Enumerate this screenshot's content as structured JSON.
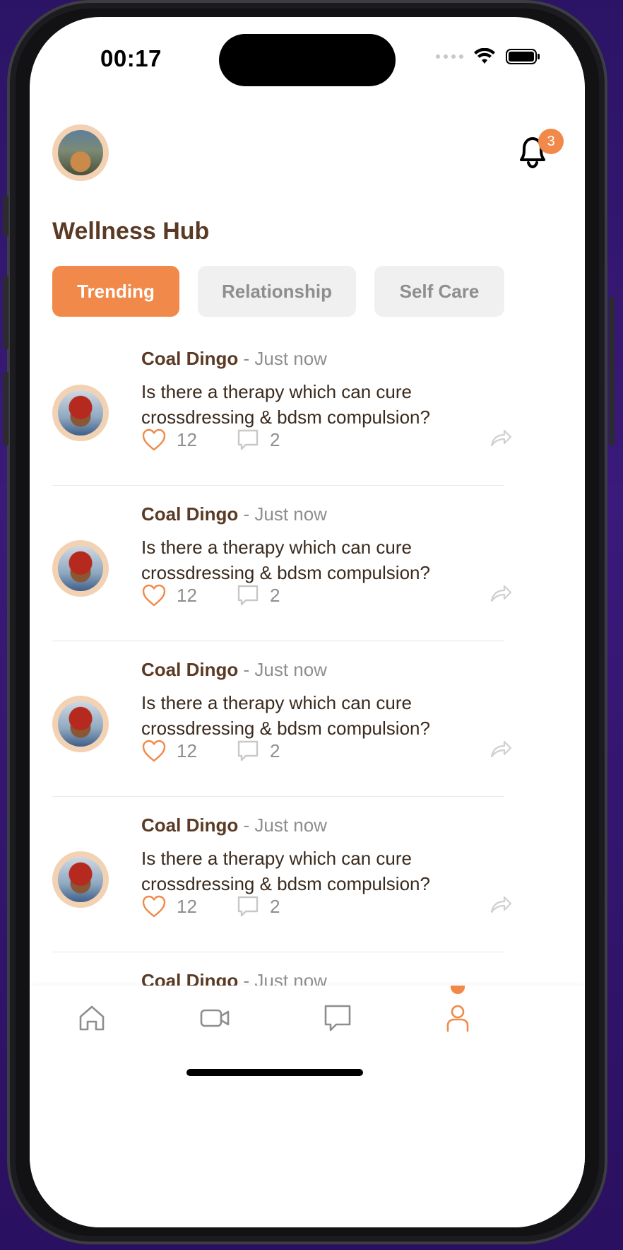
{
  "status_bar": {
    "time": "00:17"
  },
  "header": {
    "notification_count": "3",
    "title": "Wellness Hub"
  },
  "tabs": [
    {
      "label": "Trending",
      "active": true
    },
    {
      "label": "Relationship",
      "active": false
    },
    {
      "label": "Self Care",
      "active": false
    }
  ],
  "posts": [
    {
      "author": "Coal Dingo",
      "separator": "-",
      "time": "Just now",
      "text": "Is there a therapy which can cure crossdressing & bdsm compulsion?",
      "likes": "12",
      "comments": "2"
    },
    {
      "author": "Coal Dingo",
      "separator": "-",
      "time": "Just now",
      "text": "Is there a therapy which can cure crossdressing & bdsm compulsion?",
      "likes": "12",
      "comments": "2"
    },
    {
      "author": "Coal Dingo",
      "separator": "-",
      "time": "Just now",
      "text": "Is there a therapy which can cure crossdressing & bdsm compulsion?",
      "likes": "12",
      "comments": "2"
    },
    {
      "author": "Coal Dingo",
      "separator": "-",
      "time": "Just now",
      "text": "Is there a therapy which can cure crossdressing & bdsm compulsion?",
      "likes": "12",
      "comments": "2"
    },
    {
      "author": "Coal Dingo",
      "separator": "-",
      "time": "Just now"
    }
  ],
  "bottom_nav": [
    {
      "icon": "home-icon",
      "active": false
    },
    {
      "icon": "video-icon",
      "active": false
    },
    {
      "icon": "chat-icon",
      "active": false
    },
    {
      "icon": "profile-icon",
      "active": true
    }
  ],
  "colors": {
    "accent": "#f0894a",
    "title_brown": "#5a3a24",
    "muted": "#8e8e8e",
    "tab_inactive_bg": "#f0f0f0"
  }
}
